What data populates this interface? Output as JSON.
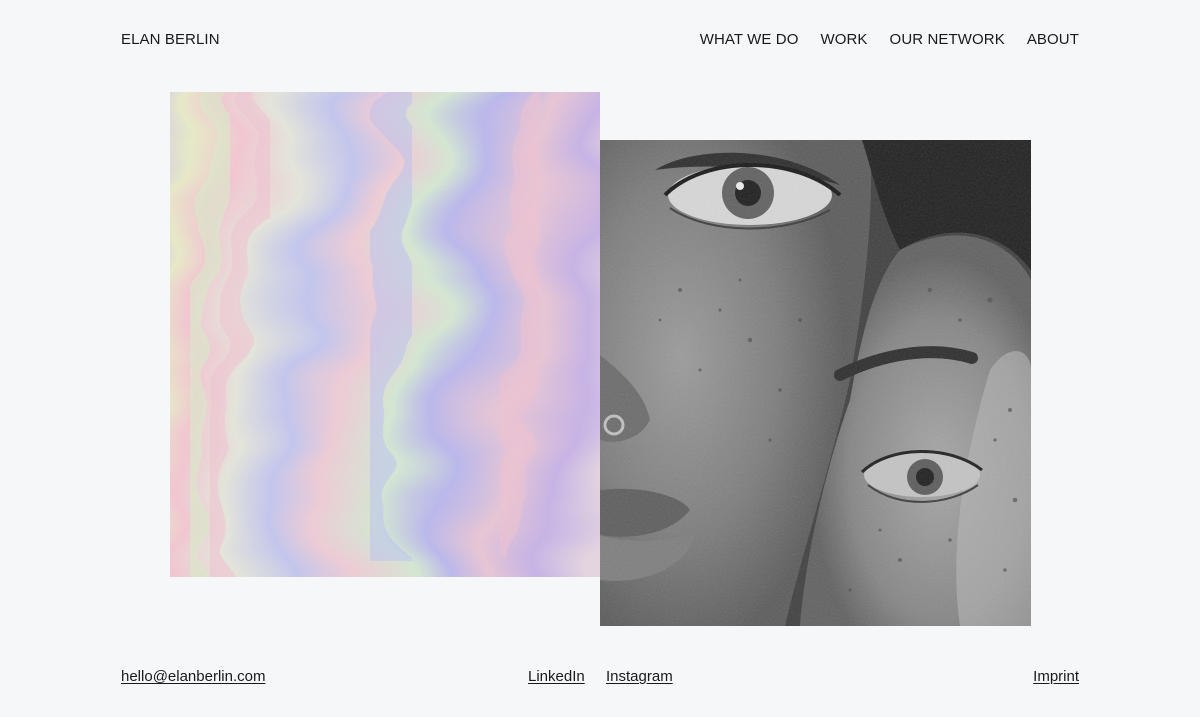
{
  "header": {
    "brand": "ELAN BERLIN",
    "nav": [
      "WHAT WE DO",
      "WORK",
      "OUR NETWORK",
      "ABOUT"
    ]
  },
  "images": {
    "left": "holographic-gradient",
    "right": "black-and-white-portrait"
  },
  "footer": {
    "email": "hello@elanberlin.com",
    "social": [
      "LinkedIn",
      "Instagram"
    ],
    "imprint": "Imprint"
  },
  "colors": {
    "background": "#f6f7f9",
    "text": "#1a1a1a"
  }
}
